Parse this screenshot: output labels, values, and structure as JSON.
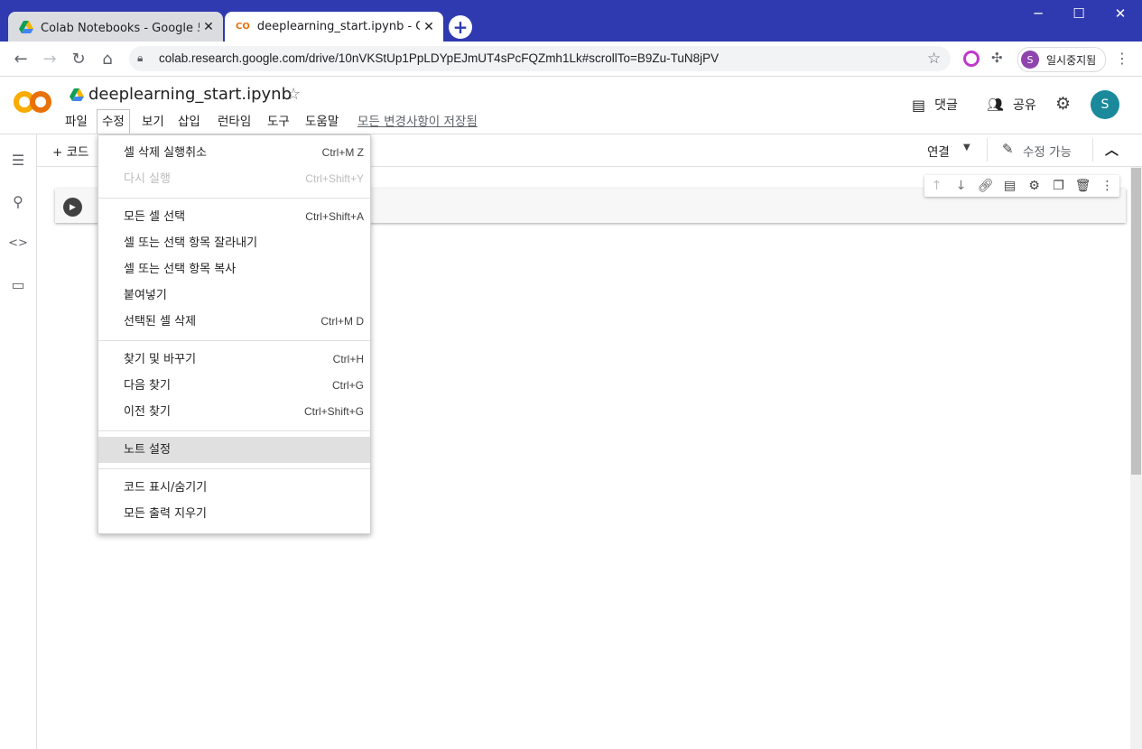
{
  "browser": {
    "tabs": [
      {
        "label": "Colab Notebooks - Google 드라이브"
      },
      {
        "label": "deeplearning_start.ipynb - Colaboratory"
      }
    ],
    "new_tab": "+",
    "window_controls": {
      "minimize": "─",
      "maximize": "☐",
      "close": "✕"
    },
    "url": "colab.research.google.com/drive/10nVKStUp1PpLDYpEJmUT4sPcFQZmh1Lk#scrollTo=B9Zu-TuN8jPV",
    "profile_initial": "S",
    "profile_label": "일시중지됨"
  },
  "colab": {
    "logo": "CO",
    "title": "deeplearning_start.ipynb",
    "menu": [
      "파일",
      "수정",
      "보기",
      "삽입",
      "런타임",
      "도구",
      "도움말"
    ],
    "saved_status": "모든 변경사항이 저장됨",
    "comment_label": "댓글",
    "share_label": "공유",
    "user_initial": "S",
    "add_code": "+ 코드",
    "connect_label": "연결",
    "edit_label": "수정 가능"
  },
  "edit_menu": {
    "groups": [
      [
        {
          "label": "셀 삭제 실행취소",
          "shortcut": "Ctrl+M Z",
          "disabled": false
        },
        {
          "label": "다시 실행",
          "shortcut": "Ctrl+Shift+Y",
          "disabled": true
        }
      ],
      [
        {
          "label": "모든 셀 선택",
          "shortcut": "Ctrl+Shift+A",
          "disabled": false
        },
        {
          "label": "셀 또는 선택 항목 잘라내기",
          "shortcut": "",
          "disabled": false
        },
        {
          "label": "셀 또는 선택 항목 복사",
          "shortcut": "",
          "disabled": false
        },
        {
          "label": "붙여넣기",
          "shortcut": "",
          "disabled": false
        },
        {
          "label": "선택된 셀 삭제",
          "shortcut": "Ctrl+M D",
          "disabled": false
        }
      ],
      [
        {
          "label": "찾기 및 바꾸기",
          "shortcut": "Ctrl+H",
          "disabled": false
        },
        {
          "label": "다음 찾기",
          "shortcut": "Ctrl+G",
          "disabled": false
        },
        {
          "label": "이전 찾기",
          "shortcut": "Ctrl+Shift+G",
          "disabled": false
        }
      ],
      [
        {
          "label": "노트 설정",
          "shortcut": "",
          "disabled": false,
          "highlighted": true
        }
      ],
      [
        {
          "label": "코드 표시/숨기기",
          "shortcut": "",
          "disabled": false
        },
        {
          "label": "모든 출력 지우기",
          "shortcut": "",
          "disabled": false
        }
      ]
    ]
  },
  "colors": {
    "titlebar": "#2f3ab0",
    "logo_orange": "#f9ab00",
    "logo_dark": "#e8710a",
    "user_avatar": "#1a8a9b"
  }
}
